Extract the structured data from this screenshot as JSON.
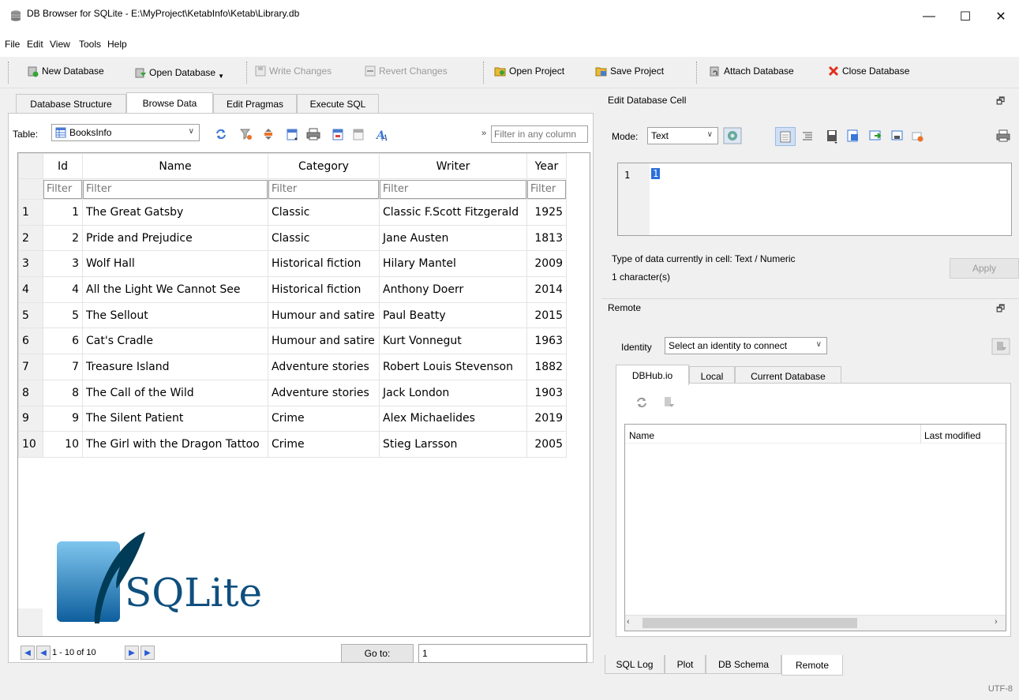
{
  "window": {
    "title": "DB Browser for SQLite - E:\\MyProject\\KetabInfo\\Ketab\\Library.db",
    "minimize": "—",
    "maximize": "☐",
    "close": "✕"
  },
  "menu": [
    "File",
    "Edit",
    "View",
    "Tools",
    "Help"
  ],
  "toolbar": {
    "new_database": "New Database",
    "open_database": "Open Database",
    "write_changes": "Write Changes",
    "revert_changes": "Revert Changes",
    "open_project": "Open Project",
    "save_project": "Save Project",
    "attach_database": "Attach Database",
    "close_database": "Close Database"
  },
  "main_tabs": [
    "Database Structure",
    "Browse Data",
    "Edit Pragmas",
    "Execute SQL"
  ],
  "active_main_tab": "Browse Data",
  "browse": {
    "table_label": "Table:",
    "table_name": "BooksInfo",
    "filter_any_placeholder": "Filter in any column",
    "more": "»",
    "columns": [
      "Id",
      "Name",
      "Category",
      "Writer",
      "Year"
    ],
    "filter_placeholder": "Filter",
    "rows": [
      {
        "n": "1",
        "id": "1",
        "name": "The Great Gatsby",
        "category": "Classic",
        "writer": "Classic F.Scott Fitzgerald",
        "year": "1925"
      },
      {
        "n": "2",
        "id": "2",
        "name": "Pride and Prejudice",
        "category": "Classic",
        "writer": "Jane Austen",
        "year": "1813"
      },
      {
        "n": "3",
        "id": "3",
        "name": "Wolf Hall",
        "category": "Historical fiction",
        "writer": "Hilary Mantel",
        "year": "2009"
      },
      {
        "n": "4",
        "id": "4",
        "name": "All the Light We Cannot See",
        "category": "Historical fiction",
        "writer": "Anthony Doerr",
        "year": "2014"
      },
      {
        "n": "5",
        "id": "5",
        "name": "The Sellout",
        "category": "Humour and satire",
        "writer": "Paul Beatty",
        "year": "2015"
      },
      {
        "n": "6",
        "id": "6",
        "name": "Cat's Cradle",
        "category": "Humour and satire",
        "writer": "Kurt Vonnegut",
        "year": "1963"
      },
      {
        "n": "7",
        "id": "7",
        "name": "Treasure Island",
        "category": "Adventure stories",
        "writer": "Robert Louis Stevenson",
        "year": "1882"
      },
      {
        "n": "8",
        "id": "8",
        "name": "The Call of the Wild",
        "category": "Adventure stories",
        "writer": "Jack London",
        "year": "1903"
      },
      {
        "n": "9",
        "id": "9",
        "name": "The Silent Patient",
        "category": "Crime",
        "writer": "Alex Michaelides",
        "year": "2019"
      },
      {
        "n": "10",
        "id": "10",
        "name": "The Girl with the Dragon Tattoo",
        "category": "Crime",
        "writer": "Stieg Larsson",
        "year": "2005"
      }
    ],
    "logo_text": "SQLite",
    "pager": "1 - 10 of 10",
    "goto_label": "Go to:",
    "goto_value": "1"
  },
  "edit_cell": {
    "title": "Edit Database Cell",
    "mode_label": "Mode:",
    "mode_value": "Text",
    "line_number": "1",
    "cell_value": "1",
    "type_info": "Type of data currently in cell: Text / Numeric",
    "char_count": "1 character(s)",
    "apply": "Apply"
  },
  "remote": {
    "title": "Remote",
    "identity_label": "Identity",
    "identity_value": "Select an identity to connect",
    "tabs": [
      "DBHub.io",
      "Local",
      "Current Database"
    ],
    "columns": [
      "Name",
      "Last modified"
    ]
  },
  "bottom_tabs": [
    "SQL Log",
    "Plot",
    "DB Schema",
    "Remote"
  ],
  "active_bottom_tab": "Remote",
  "status": {
    "encoding": "UTF-8"
  }
}
